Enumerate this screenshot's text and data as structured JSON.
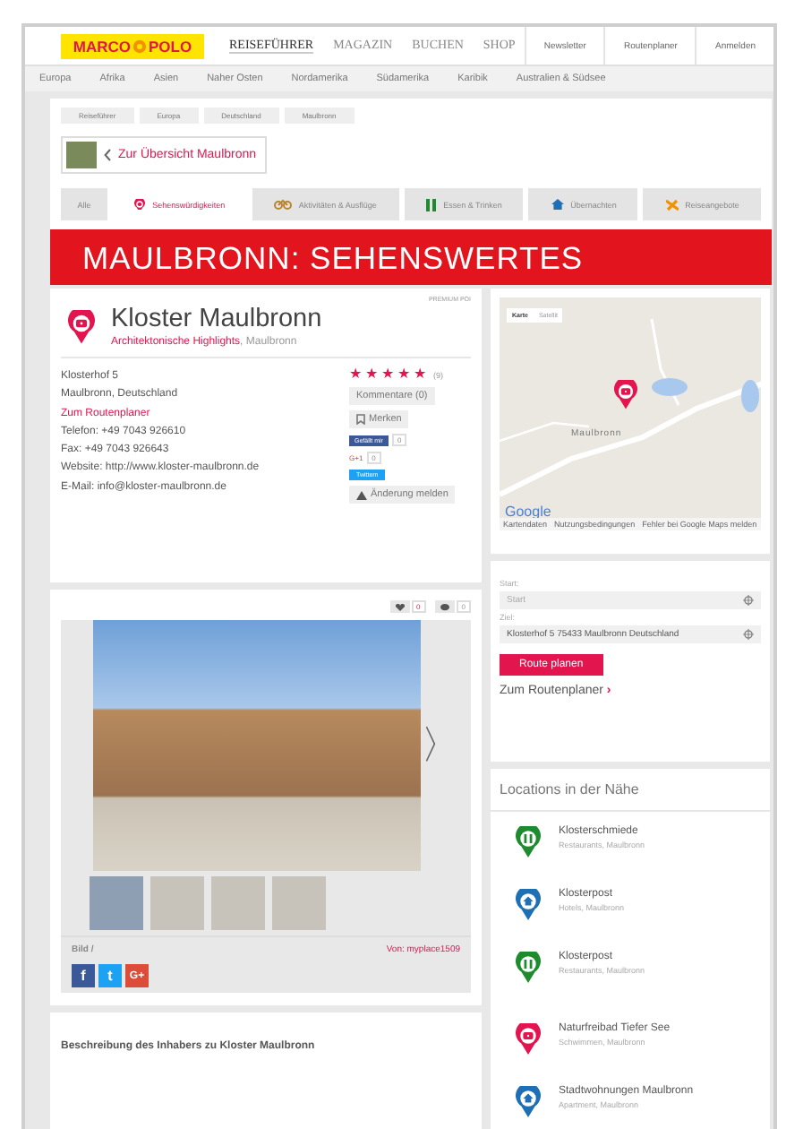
{
  "header": {
    "logo": {
      "left": "MARCO",
      "right": "POLO"
    },
    "nav": [
      {
        "label": "REISEFÜHRER",
        "selected": true
      },
      {
        "label": "MAGAZIN",
        "selected": false
      },
      {
        "label": "BUCHEN",
        "selected": false
      },
      {
        "label": "SHOP",
        "selected": false
      }
    ],
    "links": [
      "Newsletter",
      "Routenplaner",
      "Anmelden"
    ]
  },
  "regions": [
    "Europa",
    "Afrika",
    "Asien",
    "Naher Osten",
    "Nordamerika",
    "Südamerika",
    "Karibik",
    "Australien & Südsee"
  ],
  "breadcrumb": [
    "Reiseführer",
    "Europa",
    "Deutschland",
    "Maulbronn"
  ],
  "back_link": "Zur Übersicht Maulbronn",
  "tabs": [
    {
      "label": "Alle",
      "kind": "all",
      "selected": false
    },
    {
      "label": "Sehenswürdigkeiten",
      "kind": "sight",
      "selected": true
    },
    {
      "label": "Aktivitäten & Ausflüge",
      "kind": "activity",
      "selected": false
    },
    {
      "label": "Essen & Trinken",
      "kind": "food",
      "selected": false
    },
    {
      "label": "Übernachten",
      "kind": "hotel",
      "selected": false
    },
    {
      "label": "Reiseangebote",
      "kind": "travel",
      "selected": false
    }
  ],
  "banner": "MAULBRONN: SEHENSWERTES",
  "poi": {
    "badge": "PREMIUM POI",
    "title": "Kloster Maulbronn",
    "category": "Architektonische Highlights",
    "place": ", Maulbronn",
    "address": [
      {
        "text": "Klosterhof 5",
        "kind": "text"
      },
      {
        "text": "Maulbronn, Deutschland",
        "kind": "text"
      },
      {
        "text": "Zum Routenplaner",
        "kind": "link"
      },
      {
        "text": "Telefon: +49 7043 926610",
        "kind": "text"
      },
      {
        "text": "Fax: +49 7043 926643",
        "kind": "text"
      },
      {
        "text": "Website: http://www.kloster-maulbronn.de",
        "kind": "text"
      },
      {
        "text": "E-Mail: info@kloster-maulbronn.de",
        "kind": "text"
      }
    ],
    "stars": 5,
    "rating_count": "(9)",
    "comments_button": "Kommentare (0)",
    "save_button": "Merken",
    "facebook": {
      "label": "Gefällt mir",
      "count": "0"
    },
    "gplus": {
      "label": "G+1",
      "count": "0"
    },
    "twitter": "Twittern",
    "report_button": "Änderung melden"
  },
  "gallery": {
    "likes": "0",
    "comments": "0",
    "next": "〉",
    "thumbnails": [
      {
        "selected": true
      },
      {
        "selected": false
      },
      {
        "selected": false
      },
      {
        "selected": false
      }
    ],
    "caption": "Bild /",
    "credit": "Von: myplace1509",
    "share": [
      {
        "kind": "facebook",
        "label": "f"
      },
      {
        "kind": "twitter",
        "label": "t"
      },
      {
        "kind": "gplus",
        "label": "G+"
      }
    ]
  },
  "description": {
    "title": "Beschreibung des Inhabers zu Kloster Maulbronn"
  },
  "map": {
    "modes": [
      {
        "label": "Karte",
        "selected": true
      },
      {
        "label": "Satellit",
        "selected": false
      }
    ],
    "town": "Maulbronn",
    "logo": "Google",
    "footer": [
      "Kartendaten",
      "Nutzungsbedingungen",
      "Fehler bei Google Maps melden"
    ]
  },
  "route": {
    "start_label": "Start:",
    "start": {
      "placeholder": "Start"
    },
    "end_label": "Ziel:",
    "end": {
      "value": "Klosterhof 5 75433 Maulbronn Deutschland"
    },
    "button": "Route planen",
    "link": "Zum Routenplaner",
    "link_arrow": "›"
  },
  "nearby": {
    "title": "Locations in der Nähe",
    "items": [
      {
        "name": "Klosterschmiede",
        "sub": "Restaurants, Maulbronn",
        "kind": "food",
        "color": "#1e8c2e"
      },
      {
        "name": "Klosterpost",
        "sub": "Hotels, Maulbronn",
        "kind": "hotel",
        "color": "#1f6fb5"
      },
      {
        "name": "Klosterpost",
        "sub": "Restaurants, Maulbronn",
        "kind": "food",
        "color": "#1e8c2e"
      },
      {
        "name": "Naturfreibad Tiefer See",
        "sub": "Schwimmen, Maulbronn",
        "kind": "sight",
        "color": "#e2154e"
      },
      {
        "name": "Stadtwohnungen Maulbronn",
        "sub": "Apartment, Maulbronn",
        "kind": "hotel",
        "color": "#1f6fb5"
      }
    ]
  }
}
